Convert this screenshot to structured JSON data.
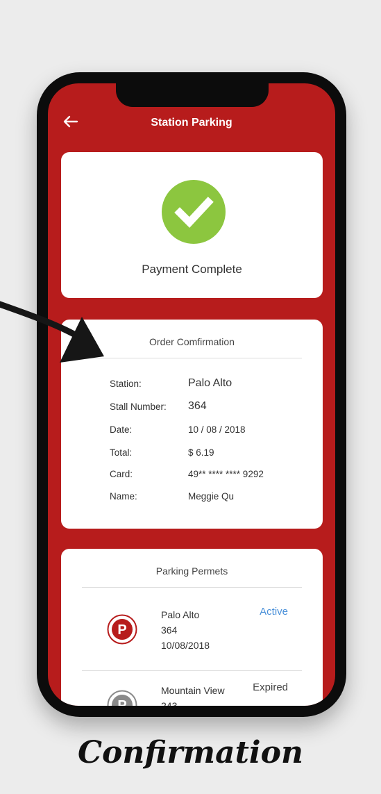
{
  "header": {
    "title": "Station Parking",
    "back_icon": "back-arrow-icon"
  },
  "payment": {
    "status_text": "Payment Complete",
    "icon": "checkmark-icon",
    "icon_color": "#8cc63f"
  },
  "order": {
    "heading": "Order Comfirmation",
    "rows": [
      {
        "label": "Station:",
        "value": "Palo Alto"
      },
      {
        "label": "Stall Number:",
        "value": "364"
      },
      {
        "label": "Date:",
        "value": "10 / 08 / 2018"
      },
      {
        "label": "Total:",
        "value": "$ 6.19"
      },
      {
        "label": "Card:",
        "value": "49** **** **** 9292"
      },
      {
        "label": "Name:",
        "value": "Meggie Qu"
      }
    ]
  },
  "permits": {
    "heading": "Parking Permets",
    "items": [
      {
        "station": "Palo Alto",
        "stall": "364",
        "date": "10/08/2018",
        "status": "Active",
        "status_color": "#4a90d9",
        "icon": "parking-icon"
      },
      {
        "station": "Mountain View",
        "stall": "243",
        "status": "Expired",
        "status_color": "#444444",
        "icon": "parking-icon"
      }
    ]
  },
  "caption": "Confirmation",
  "colors": {
    "brand": "#b71c1c",
    "background": "#ececec",
    "active": "#4a90d9"
  }
}
